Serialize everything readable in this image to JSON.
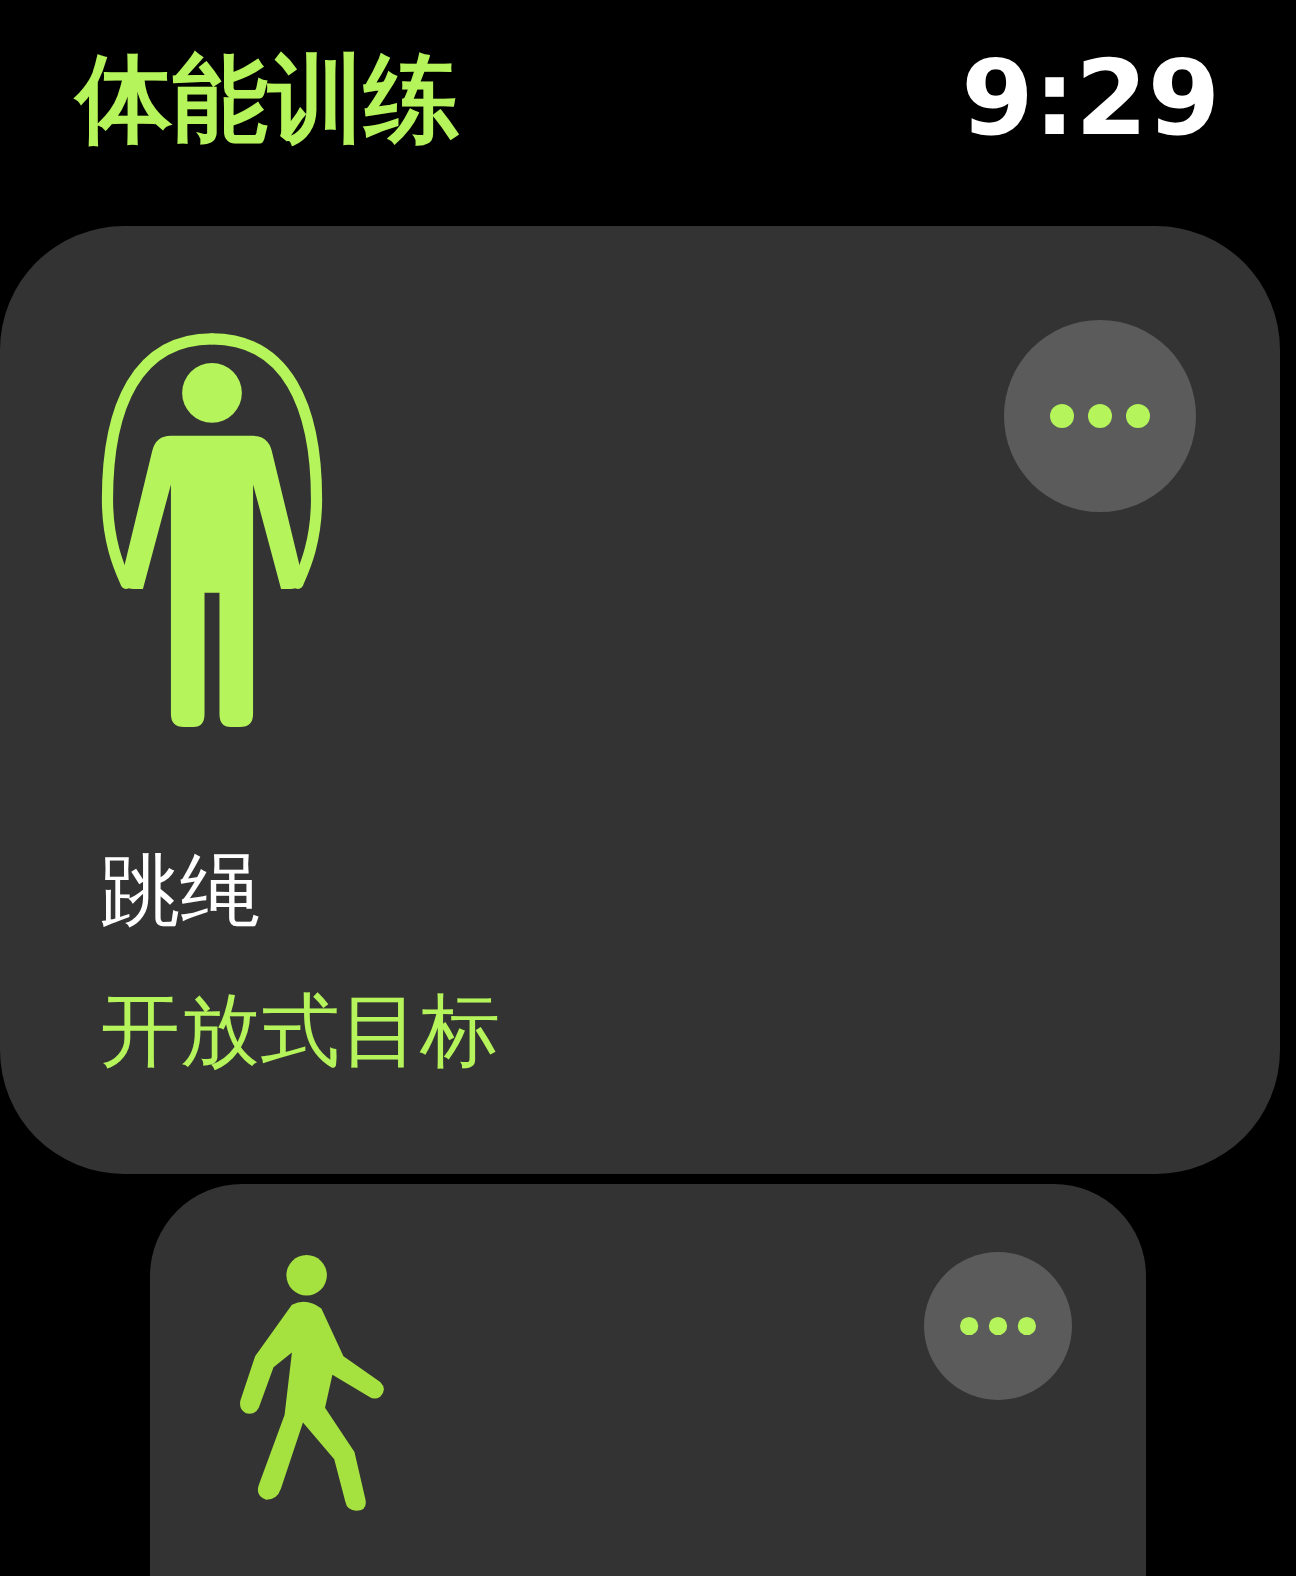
{
  "header": {
    "title": "体能训练",
    "time": "9:29"
  },
  "workouts": [
    {
      "kind": "jump-rope",
      "name": "跳绳",
      "goal": "开放式目标"
    },
    {
      "kind": "walk"
    }
  ]
}
